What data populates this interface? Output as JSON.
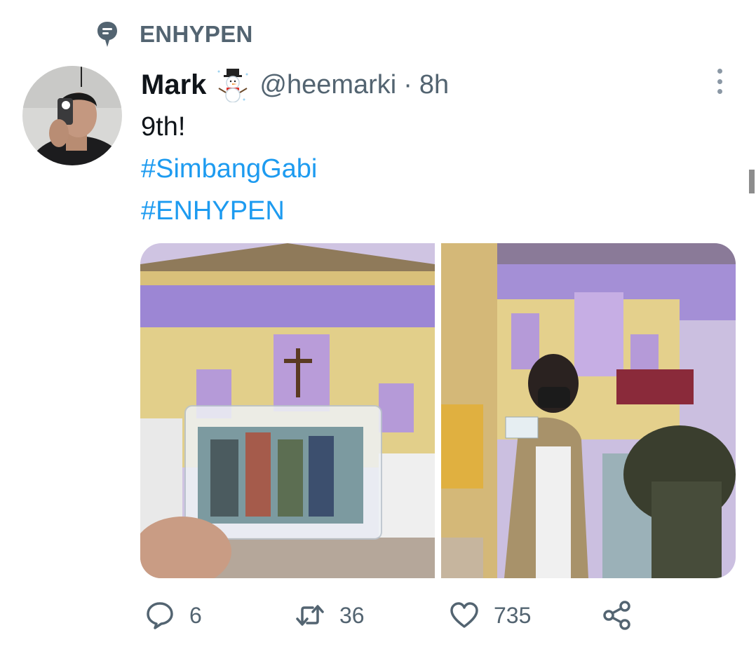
{
  "topic": {
    "icon": "topic-bubble-icon",
    "label": "ENHYPEN"
  },
  "tweet": {
    "display_name": "Mark",
    "emoji": "snowman-emoji",
    "handle": "@heemarki",
    "separator": "·",
    "time": "8h",
    "text_line1": "9th!",
    "hashtag1": "#SimbangGabi",
    "hashtag2": "#ENHYPEN"
  },
  "media": {
    "count": 2
  },
  "actions": {
    "reply": {
      "icon": "reply-icon",
      "count": "6"
    },
    "retweet": {
      "icon": "retweet-icon",
      "count": "36"
    },
    "like": {
      "icon": "heart-icon",
      "count": "735"
    },
    "share": {
      "icon": "share-icon"
    }
  },
  "colors": {
    "link": "#1d9bf0",
    "secondary": "#536471",
    "text": "#0f1419"
  }
}
